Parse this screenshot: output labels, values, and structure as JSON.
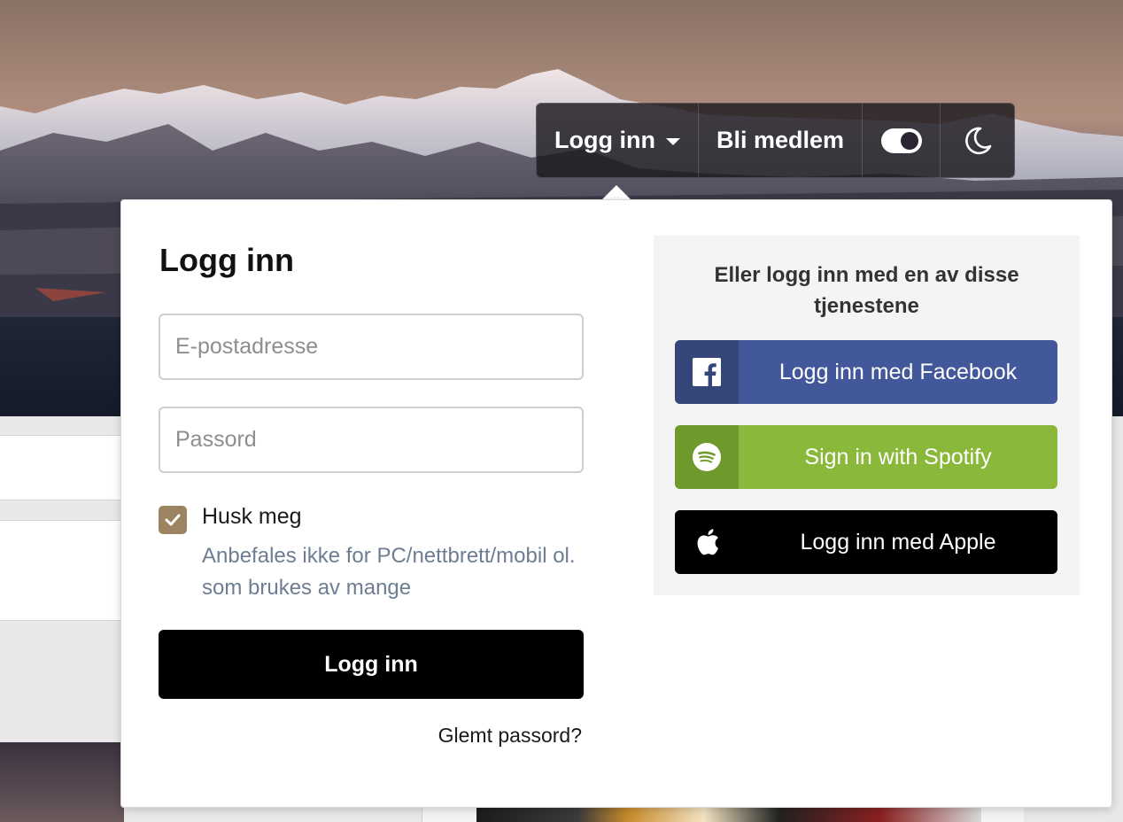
{
  "topnav": {
    "login_label": "Logg inn",
    "join_label": "Bli medlem",
    "icons": [
      "caret-down-icon",
      "toggle-icon",
      "moon-icon"
    ]
  },
  "login_form": {
    "title": "Logg inn",
    "email_placeholder": "E-postadresse",
    "email_value": "",
    "password_placeholder": "Passord",
    "password_value": "",
    "remember_label": "Husk meg",
    "remember_checked": true,
    "remember_hint": "Anbefales ikke for PC/nettbrett/mobil ol. som brukes av mange",
    "submit_label": "Logg inn",
    "forgot_label": "Glemt passord?"
  },
  "social": {
    "heading": "Eller logg inn med en av disse tjenestene",
    "buttons": [
      {
        "label": "Logg inn med Facebook",
        "icon": "facebook-icon",
        "color": "#43589a"
      },
      {
        "label": "Sign in with Spotify",
        "icon": "spotify-icon",
        "color": "#89b83a"
      },
      {
        "label": "Logg inn med Apple",
        "icon": "apple-icon",
        "color": "#000000"
      }
    ]
  },
  "colors": {
    "accent_checkbox": "#9d8460",
    "hint_text": "#6d7d93",
    "primary_button": "#000000"
  }
}
